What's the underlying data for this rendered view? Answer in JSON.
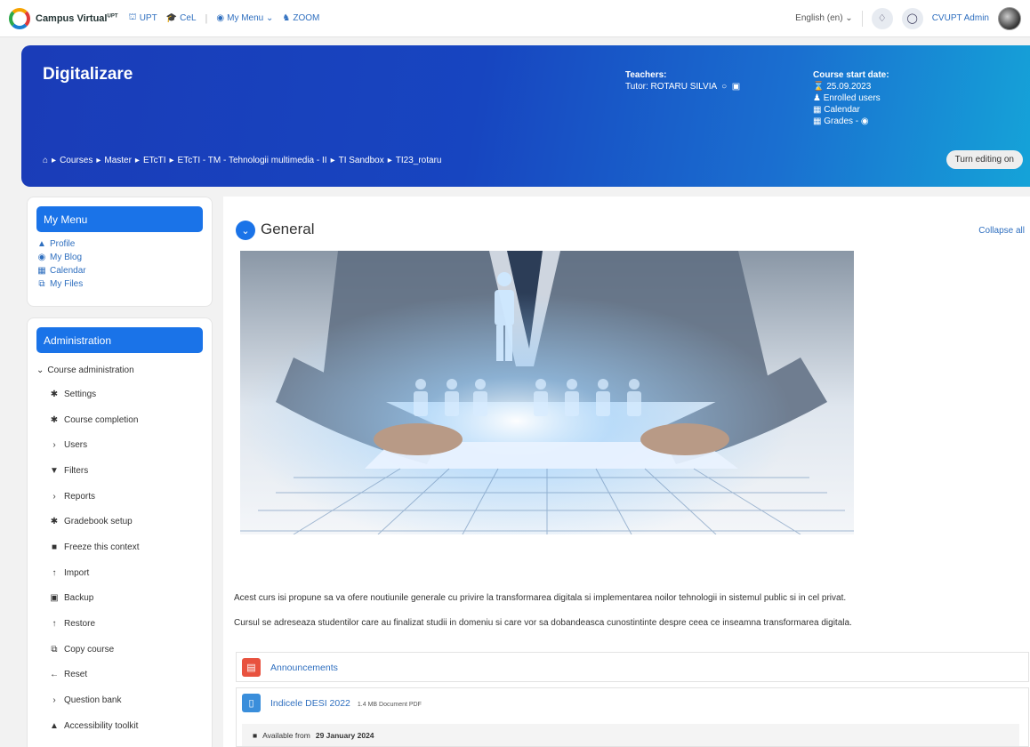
{
  "topbar": {
    "brand": "Campus Virtual",
    "brand_sup": "UPT",
    "links": [
      {
        "label": "UPT",
        "icon": "bank-icon"
      },
      {
        "label": "CeL",
        "icon": "graduation-cap-icon"
      }
    ],
    "separator": "|",
    "menu_links": [
      {
        "label": "My Menu ⌄",
        "icon": "binoculars-icon"
      },
      {
        "label": "ZOOM",
        "icon": "people-icon"
      }
    ],
    "language": "English (en) ⌄",
    "username": "CVUPT Admin"
  },
  "banner": {
    "title": "Digitalizare",
    "teachers_heading": "Teachers:",
    "tutor": "Tutor: ROTARU SILVIA",
    "start_heading": "Course start date:",
    "start_date": "25.09.2023",
    "enrolled": "Enrolled users",
    "calendar": "Calendar",
    "grades": "Grades - ◉",
    "breadcrumbs": [
      "Courses",
      "Master",
      "ETcTI",
      "ETcTI - TM - Tehnologii multimedia - II",
      "TI Sandbox",
      "TI23_rotaru"
    ],
    "turn_editing": "Turn editing on"
  },
  "mymenu": {
    "heading": "My Menu",
    "items": [
      {
        "label": "Profile",
        "icon": "▲"
      },
      {
        "label": "My Blog",
        "icon": "◉"
      },
      {
        "label": "Calendar",
        "icon": "▦"
      },
      {
        "label": "My Files",
        "icon": "⧉"
      }
    ]
  },
  "admin": {
    "heading": "Administration",
    "root": "Course administration",
    "items": [
      {
        "label": "Settings",
        "icon": "✱"
      },
      {
        "label": "Course completion",
        "icon": "✱"
      },
      {
        "label": "Users",
        "icon": "›"
      },
      {
        "label": "Filters",
        "icon": "▼"
      },
      {
        "label": "Reports",
        "icon": "›"
      },
      {
        "label": "Gradebook setup",
        "icon": "✱"
      },
      {
        "label": "Freeze this context",
        "icon": "■"
      },
      {
        "label": "Import",
        "icon": "↑"
      },
      {
        "label": "Backup",
        "icon": "▣"
      },
      {
        "label": "Restore",
        "icon": "↑"
      },
      {
        "label": "Copy course",
        "icon": "⧉"
      },
      {
        "label": "Reset",
        "icon": "←"
      },
      {
        "label": "Question bank",
        "icon": "›"
      },
      {
        "label": "Accessibility toolkit",
        "icon": "▲"
      }
    ]
  },
  "main": {
    "section_title": "General",
    "collapse_all": "Collapse all",
    "para1": "Acest curs isi propune sa va ofere noutiunile generale cu privire la transformarea digitala si implementarea noilor tehnologii in sistemul public si in cel privat.",
    "para2": "Cursul se adreseaza studentilor care au finalizat studii in domeniu si care vor sa dobandeasca cunostintinte despre ceea ce inseamna transformarea digitala.",
    "activities": [
      {
        "name": "Announcements",
        "icon": "forum-icon",
        "color": "#e8523f"
      },
      {
        "name": "Indicele DESI 2022",
        "meta": "1.4 MB Document PDF",
        "icon": "file-icon",
        "color": "#3a8edb",
        "restriction_prefix": "Available from",
        "restriction_date": "29 January 2024"
      }
    ]
  }
}
